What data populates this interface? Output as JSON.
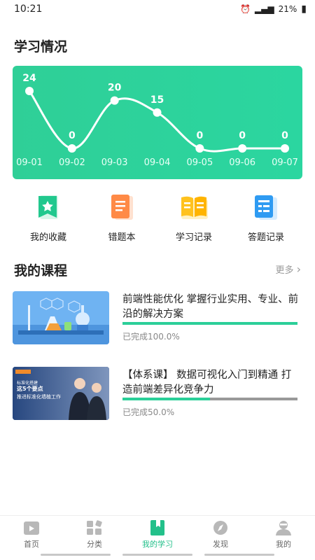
{
  "status": {
    "time": "10:21",
    "battery": "21%"
  },
  "learning": {
    "title": "学习情况"
  },
  "chart_data": {
    "type": "line",
    "categories": [
      "09-01",
      "09-02",
      "09-03",
      "09-04",
      "09-05",
      "09-06",
      "09-07"
    ],
    "values": [
      24,
      0,
      20,
      15,
      0,
      0,
      0
    ],
    "title": "",
    "xlabel": "",
    "ylabel": "",
    "color": "#ffffff",
    "background": "#2bd39c"
  },
  "quick": [
    {
      "label": "我的收藏",
      "icon": "star-bookmark-icon"
    },
    {
      "label": "错题本",
      "icon": "notebook-icon"
    },
    {
      "label": "学习记录",
      "icon": "open-book-icon"
    },
    {
      "label": "答题记录",
      "icon": "answer-sheet-icon"
    }
  ],
  "courses_section": {
    "title": "我的课程",
    "more": "更多"
  },
  "courses": [
    {
      "title": "前端性能优化 掌握行业实用、专业、前沿的解决方案",
      "progress": 1.0,
      "status": "已完成100.0%"
    },
    {
      "title": "【体系课】 数据可视化入门到精通 打造前端差异化竞争力",
      "progress": 0.5,
      "status": "已完成50.0%",
      "thumb_text": {
        "l1": "标准化搭建",
        "l2": "这5个要点",
        "l3": "推进标准化墙植工作"
      }
    }
  ],
  "tabs": [
    {
      "label": "首页",
      "icon": "home-icon"
    },
    {
      "label": "分类",
      "icon": "category-grid-icon"
    },
    {
      "label": "我的学习",
      "icon": "study-bookmark-icon",
      "active": true
    },
    {
      "label": "发现",
      "icon": "compass-icon"
    },
    {
      "label": "我的",
      "icon": "user-icon"
    }
  ],
  "colors": {
    "accent": "#23c08a",
    "chart": "#2bd39c"
  }
}
